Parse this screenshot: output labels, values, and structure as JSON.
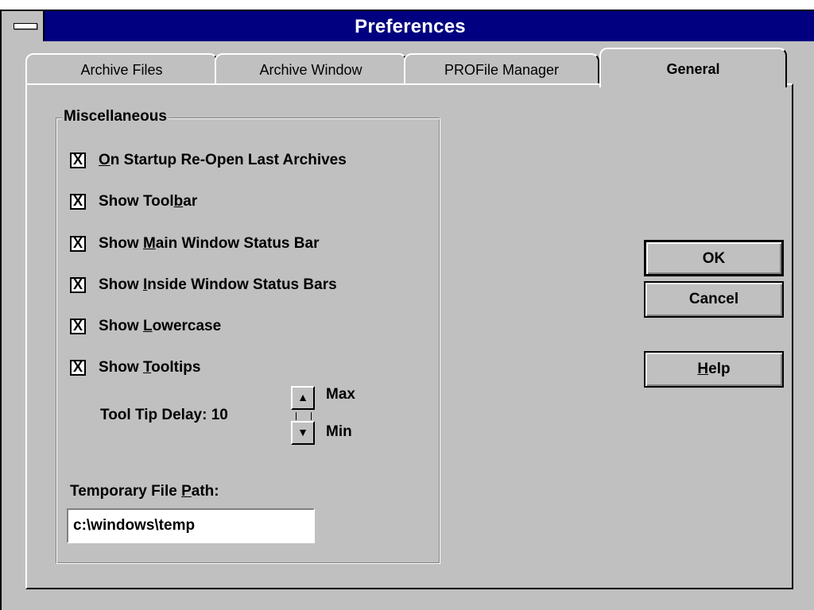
{
  "window": {
    "title": "Preferences"
  },
  "tabs": [
    {
      "label": "Archive Files",
      "active": false
    },
    {
      "label": "Archive Window",
      "active": false
    },
    {
      "label": "PROFile Manager",
      "active": false
    },
    {
      "label": "General",
      "active": true
    }
  ],
  "group": {
    "title": "Miscellaneous",
    "checkboxes": [
      {
        "pre": "",
        "u": "O",
        "post": "n Startup Re-Open Last Archives",
        "checked": true
      },
      {
        "pre": "Show Tool",
        "u": "b",
        "post": "ar",
        "checked": true
      },
      {
        "pre": "Show ",
        "u": "M",
        "post": "ain Window Status Bar",
        "checked": true
      },
      {
        "pre": "Show ",
        "u": "I",
        "post": "nside Window Status Bars",
        "checked": true
      },
      {
        "pre": "Show ",
        "u": "L",
        "post": "owercase",
        "checked": true
      },
      {
        "pre": "Show ",
        "u": "T",
        "post": "ooltips",
        "checked": true
      }
    ],
    "checkmark": "X",
    "delay": {
      "label": "Tool Tip Delay:  10",
      "max_label": "Max",
      "min_label": "Min",
      "up_glyph": "▲",
      "down_glyph": "▼"
    },
    "path": {
      "label_pre": "Temporary File ",
      "label_u": "P",
      "label_post": "ath:",
      "value": "c:\\windows\\temp"
    }
  },
  "buttons": {
    "ok": "OK",
    "cancel": "Cancel",
    "help_u": "H",
    "help_post": "elp"
  },
  "colors": {
    "titlebar": "#000080",
    "face": "#c0c0c0"
  }
}
